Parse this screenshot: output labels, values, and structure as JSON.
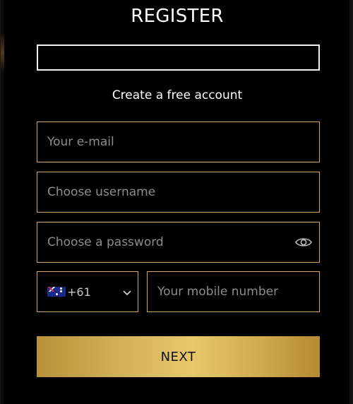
{
  "header": {
    "title": "REGISTER",
    "subtitle": "Create a free account"
  },
  "form": {
    "email": {
      "placeholder": "Your e-mail",
      "value": ""
    },
    "username": {
      "placeholder": "Choose username",
      "value": ""
    },
    "password": {
      "placeholder": "Choose a password",
      "value": ""
    },
    "country_code": {
      "value": "+61",
      "flag": "australia-flag"
    },
    "mobile": {
      "placeholder": "Your mobile number",
      "value": ""
    },
    "next_label": "NEXT"
  },
  "colors": {
    "background": "#000000",
    "field_border": "#d4a86a",
    "button_gold": "#d7b560",
    "text": "#ffffff"
  }
}
